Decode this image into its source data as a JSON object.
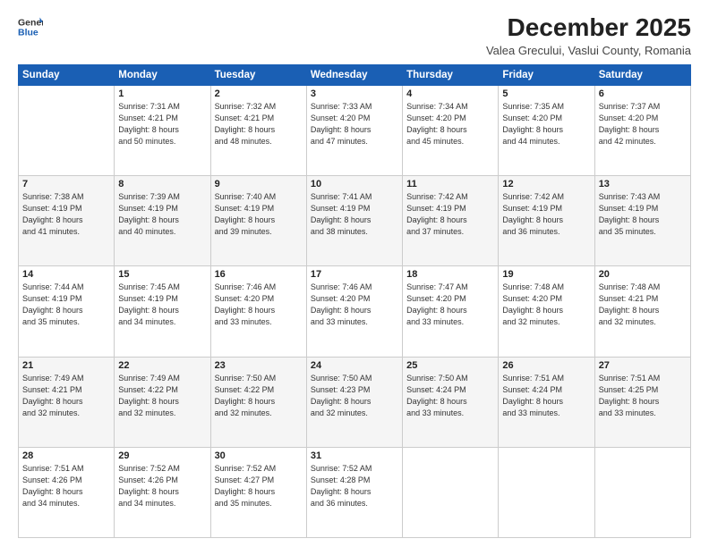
{
  "header": {
    "logo_line1": "General",
    "logo_line2": "Blue",
    "title": "December 2025",
    "subtitle": "Valea Grecului, Vaslui County, Romania"
  },
  "calendar": {
    "days_of_week": [
      "Sunday",
      "Monday",
      "Tuesday",
      "Wednesday",
      "Thursday",
      "Friday",
      "Saturday"
    ],
    "weeks": [
      [
        {
          "day": "",
          "info": ""
        },
        {
          "day": "1",
          "info": "Sunrise: 7:31 AM\nSunset: 4:21 PM\nDaylight: 8 hours\nand 50 minutes."
        },
        {
          "day": "2",
          "info": "Sunrise: 7:32 AM\nSunset: 4:21 PM\nDaylight: 8 hours\nand 48 minutes."
        },
        {
          "day": "3",
          "info": "Sunrise: 7:33 AM\nSunset: 4:20 PM\nDaylight: 8 hours\nand 47 minutes."
        },
        {
          "day": "4",
          "info": "Sunrise: 7:34 AM\nSunset: 4:20 PM\nDaylight: 8 hours\nand 45 minutes."
        },
        {
          "day": "5",
          "info": "Sunrise: 7:35 AM\nSunset: 4:20 PM\nDaylight: 8 hours\nand 44 minutes."
        },
        {
          "day": "6",
          "info": "Sunrise: 7:37 AM\nSunset: 4:20 PM\nDaylight: 8 hours\nand 42 minutes."
        }
      ],
      [
        {
          "day": "7",
          "info": "Sunrise: 7:38 AM\nSunset: 4:19 PM\nDaylight: 8 hours\nand 41 minutes."
        },
        {
          "day": "8",
          "info": "Sunrise: 7:39 AM\nSunset: 4:19 PM\nDaylight: 8 hours\nand 40 minutes."
        },
        {
          "day": "9",
          "info": "Sunrise: 7:40 AM\nSunset: 4:19 PM\nDaylight: 8 hours\nand 39 minutes."
        },
        {
          "day": "10",
          "info": "Sunrise: 7:41 AM\nSunset: 4:19 PM\nDaylight: 8 hours\nand 38 minutes."
        },
        {
          "day": "11",
          "info": "Sunrise: 7:42 AM\nSunset: 4:19 PM\nDaylight: 8 hours\nand 37 minutes."
        },
        {
          "day": "12",
          "info": "Sunrise: 7:42 AM\nSunset: 4:19 PM\nDaylight: 8 hours\nand 36 minutes."
        },
        {
          "day": "13",
          "info": "Sunrise: 7:43 AM\nSunset: 4:19 PM\nDaylight: 8 hours\nand 35 minutes."
        }
      ],
      [
        {
          "day": "14",
          "info": "Sunrise: 7:44 AM\nSunset: 4:19 PM\nDaylight: 8 hours\nand 35 minutes."
        },
        {
          "day": "15",
          "info": "Sunrise: 7:45 AM\nSunset: 4:19 PM\nDaylight: 8 hours\nand 34 minutes."
        },
        {
          "day": "16",
          "info": "Sunrise: 7:46 AM\nSunset: 4:20 PM\nDaylight: 8 hours\nand 33 minutes."
        },
        {
          "day": "17",
          "info": "Sunrise: 7:46 AM\nSunset: 4:20 PM\nDaylight: 8 hours\nand 33 minutes."
        },
        {
          "day": "18",
          "info": "Sunrise: 7:47 AM\nSunset: 4:20 PM\nDaylight: 8 hours\nand 33 minutes."
        },
        {
          "day": "19",
          "info": "Sunrise: 7:48 AM\nSunset: 4:20 PM\nDaylight: 8 hours\nand 32 minutes."
        },
        {
          "day": "20",
          "info": "Sunrise: 7:48 AM\nSunset: 4:21 PM\nDaylight: 8 hours\nand 32 minutes."
        }
      ],
      [
        {
          "day": "21",
          "info": "Sunrise: 7:49 AM\nSunset: 4:21 PM\nDaylight: 8 hours\nand 32 minutes."
        },
        {
          "day": "22",
          "info": "Sunrise: 7:49 AM\nSunset: 4:22 PM\nDaylight: 8 hours\nand 32 minutes."
        },
        {
          "day": "23",
          "info": "Sunrise: 7:50 AM\nSunset: 4:22 PM\nDaylight: 8 hours\nand 32 minutes."
        },
        {
          "day": "24",
          "info": "Sunrise: 7:50 AM\nSunset: 4:23 PM\nDaylight: 8 hours\nand 32 minutes."
        },
        {
          "day": "25",
          "info": "Sunrise: 7:50 AM\nSunset: 4:24 PM\nDaylight: 8 hours\nand 33 minutes."
        },
        {
          "day": "26",
          "info": "Sunrise: 7:51 AM\nSunset: 4:24 PM\nDaylight: 8 hours\nand 33 minutes."
        },
        {
          "day": "27",
          "info": "Sunrise: 7:51 AM\nSunset: 4:25 PM\nDaylight: 8 hours\nand 33 minutes."
        }
      ],
      [
        {
          "day": "28",
          "info": "Sunrise: 7:51 AM\nSunset: 4:26 PM\nDaylight: 8 hours\nand 34 minutes."
        },
        {
          "day": "29",
          "info": "Sunrise: 7:52 AM\nSunset: 4:26 PM\nDaylight: 8 hours\nand 34 minutes."
        },
        {
          "day": "30",
          "info": "Sunrise: 7:52 AM\nSunset: 4:27 PM\nDaylight: 8 hours\nand 35 minutes."
        },
        {
          "day": "31",
          "info": "Sunrise: 7:52 AM\nSunset: 4:28 PM\nDaylight: 8 hours\nand 36 minutes."
        },
        {
          "day": "",
          "info": ""
        },
        {
          "day": "",
          "info": ""
        },
        {
          "day": "",
          "info": ""
        }
      ]
    ]
  }
}
